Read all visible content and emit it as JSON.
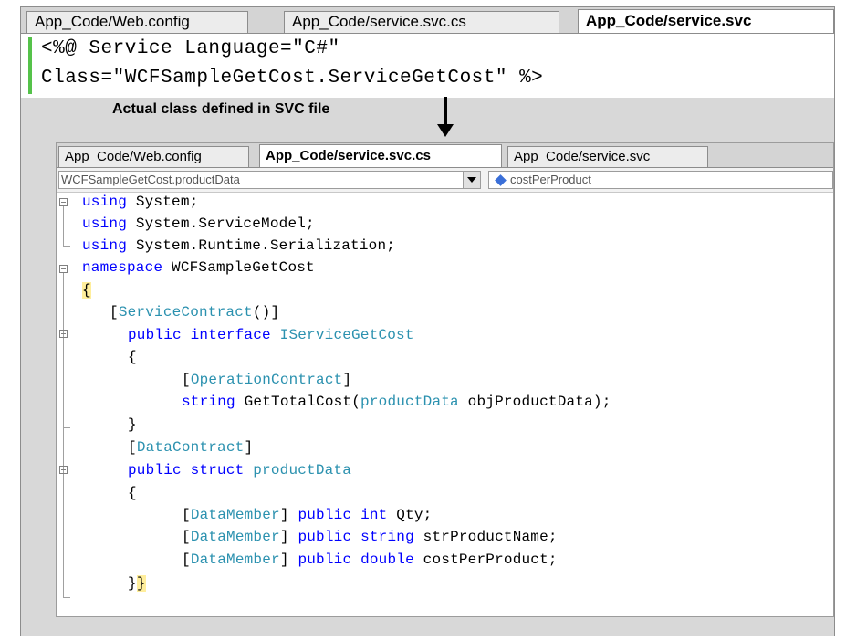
{
  "top_tabs": [
    {
      "label": "App_Code/Web.config"
    },
    {
      "label": "App_Code/service.svc.cs"
    },
    {
      "label": "App_Code/service.svc"
    }
  ],
  "svc_file": {
    "line1": "<%@ Service Language=\"C#\"",
    "line2": "Class=\"WCFSampleGetCost.ServiceGetCost\" %>"
  },
  "annotation": "Actual class defined in SVC file",
  "inner_tabs": [
    {
      "label": "App_Code/Web.config"
    },
    {
      "label": "App_Code/service.svc.cs"
    },
    {
      "label": "App_Code/service.svc"
    }
  ],
  "navbar": {
    "type_combo": "WCFSampleGetCost.productData",
    "member_combo": "costPerProduct",
    "member_icon": "field-icon"
  },
  "code": {
    "l1": {
      "kw": "using",
      "rest": " System;"
    },
    "l2": {
      "kw": "using",
      "rest": " System.ServiceModel;"
    },
    "l3": {
      "kw": "using",
      "rest": " System.Runtime.Serialization;"
    },
    "l4": {
      "kw": "namespace",
      "rest": " WCFSampleGetCost"
    },
    "l5": {
      "text": "{"
    },
    "l6": {
      "open": "[",
      "attr": "ServiceContract",
      "close": "()]"
    },
    "l7": {
      "kw": "public interface",
      "ty": "IServiceGetCost"
    },
    "l8": {
      "text": "{"
    },
    "l9": {
      "open": "[",
      "attr": "OperationContract",
      "close": "]"
    },
    "l10": {
      "kw": "string",
      "mid": " GetTotalCost(",
      "ty": "productData",
      "rest": " objProductData);"
    },
    "l11": {
      "text": "}"
    },
    "l12": {
      "open": "[",
      "attr": "DataContract",
      "close": "]"
    },
    "l13": {
      "kw": "public struct",
      "ty": "productData"
    },
    "l14": {
      "text": "{"
    },
    "l15": {
      "open": "[",
      "attr": "DataMember",
      "close": "]",
      "kw": "public int",
      "rest": " Qty;"
    },
    "l16": {
      "open": "[",
      "attr": "DataMember",
      "close": "]",
      "kw": "public string",
      "rest": " strProductName;"
    },
    "l17": {
      "open": "[",
      "attr": "DataMember",
      "close": "]",
      "kw": "public double",
      "rest": " costPerProduct;"
    },
    "l18": {
      "a": "}",
      "b": "}"
    }
  }
}
